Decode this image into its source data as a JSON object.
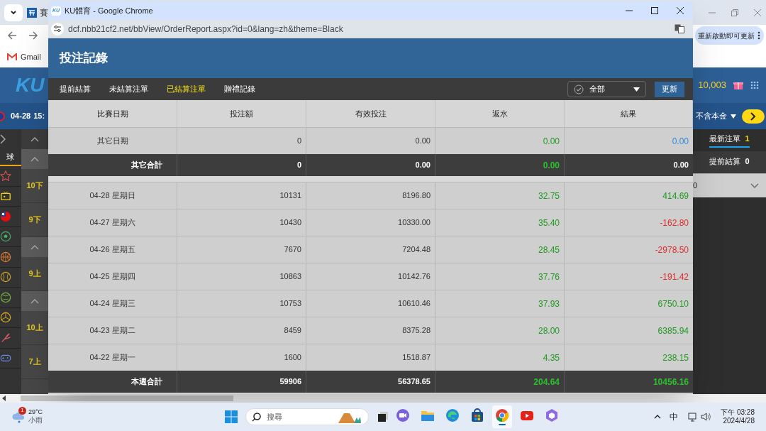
{
  "background_browser": {
    "tab_title": "賽",
    "update_notice": "重新啟動即可更新",
    "bookmarks": [
      "Gmail"
    ],
    "site": {
      "logo": "KU",
      "balance": "10,003",
      "date": "04-28",
      "time": "15:",
      "stake_option": "不含本金",
      "sports_tab": "球",
      "periods": [
        {
          "kind": "collapse"
        },
        {
          "kind": "collapse"
        },
        {
          "kind": "label",
          "text": "10下"
        },
        {
          "kind": "label",
          "text": "9下"
        },
        {
          "kind": "collapse"
        },
        {
          "kind": "label",
          "text": "9上"
        },
        {
          "kind": "collapse"
        },
        {
          "kind": "label",
          "text": "10上"
        },
        {
          "kind": "label",
          "text": "7上"
        }
      ],
      "sports": [
        {
          "kind": "star"
        },
        {
          "kind": "tv"
        },
        {
          "kind": "flag"
        },
        {
          "kind": "soccer"
        },
        {
          "kind": "basketball"
        },
        {
          "kind": "baseball"
        },
        {
          "kind": "tennis"
        },
        {
          "kind": "volleyball"
        },
        {
          "kind": "badminton"
        },
        {
          "kind": "gamepad"
        }
      ],
      "bet_tabs": [
        {
          "label": "最新注單",
          "count": "1",
          "selected": true
        },
        {
          "label": "提前結算",
          "count": "0",
          "selected": false
        }
      ],
      "bet_row": "0"
    }
  },
  "popup": {
    "favicon": "KU",
    "window_title": "KU體育 - Google Chrome",
    "url": "dcf.nbb21cf2.net/bbView/OrderReport.aspx?id=0&lang=zh&theme=Black",
    "page_title": "投注記錄",
    "tabs": [
      {
        "label": "提前結算",
        "selected": false
      },
      {
        "label": "未結算注單",
        "selected": false
      },
      {
        "label": "已結算注單",
        "selected": true
      },
      {
        "label": "贈禮記錄",
        "selected": false
      }
    ],
    "filter": "全部",
    "refresh_button": "更新",
    "columns": [
      "比賽日期",
      "投注額",
      "有效投注",
      "返水",
      "結果"
    ],
    "rows": [
      {
        "kind": "day",
        "date": "其它日期",
        "stake": "0",
        "valid": "0.00",
        "rebate": {
          "text": "0.00",
          "color": "#1f9a1f"
        },
        "result": {
          "text": "0.00",
          "color": "#2f8ae0"
        }
      },
      {
        "kind": "total",
        "date": "其它合計",
        "stake": "0",
        "valid": "0.00",
        "rebate": {
          "text": "0.00",
          "color": "#2cc02c"
        },
        "result": {
          "text": "0.00"
        }
      },
      {
        "kind": "spacer"
      },
      {
        "kind": "day",
        "date": "04-28 星期日",
        "stake": "10131",
        "valid": "8196.80",
        "rebate": {
          "text": "32.75",
          "color": "#1f9a1f"
        },
        "result": {
          "text": "414.69",
          "color": "#1f9a1f"
        }
      },
      {
        "kind": "day",
        "date": "04-27 星期六",
        "stake": "10430",
        "valid": "10330.00",
        "rebate": {
          "text": "35.40",
          "color": "#1f9a1f"
        },
        "result": {
          "text": "-162.80",
          "color": "#e02a2a"
        }
      },
      {
        "kind": "day",
        "date": "04-26 星期五",
        "stake": "7670",
        "valid": "7204.48",
        "rebate": {
          "text": "28.45",
          "color": "#1f9a1f"
        },
        "result": {
          "text": "-2978.50",
          "color": "#e02a2a"
        }
      },
      {
        "kind": "day",
        "date": "04-25 星期四",
        "stake": "10863",
        "valid": "10142.76",
        "rebate": {
          "text": "37.76",
          "color": "#1f9a1f"
        },
        "result": {
          "text": "-191.42",
          "color": "#e02a2a"
        }
      },
      {
        "kind": "day",
        "date": "04-24 星期三",
        "stake": "10753",
        "valid": "10610.46",
        "rebate": {
          "text": "37.93",
          "color": "#1f9a1f"
        },
        "result": {
          "text": "6750.10",
          "color": "#1f9a1f"
        }
      },
      {
        "kind": "day",
        "date": "04-23 星期二",
        "stake": "8459",
        "valid": "8375.28",
        "rebate": {
          "text": "28.00",
          "color": "#1f9a1f"
        },
        "result": {
          "text": "6385.94",
          "color": "#1f9a1f"
        }
      },
      {
        "kind": "day",
        "date": "04-22 星期一",
        "stake": "1600",
        "valid": "1518.87",
        "rebate": {
          "text": "4.35",
          "color": "#1f9a1f"
        },
        "result": {
          "text": "238.15",
          "color": "#1f9a1f"
        }
      },
      {
        "kind": "total",
        "date": "本週合計",
        "stake": "59906",
        "valid": "56378.65",
        "rebate": {
          "text": "204.64",
          "color": "#2cc02c"
        },
        "result": {
          "text": "10456.16",
          "color": "#2cc02c"
        }
      }
    ]
  },
  "taskbar": {
    "weather_badge": "1",
    "temperature": "29°C",
    "weather": "小雨",
    "search_placeholder": "搜尋",
    "apps": [
      {
        "kind": "meet",
        "selected": false
      },
      {
        "kind": "folder",
        "selected": false
      },
      {
        "kind": "edge",
        "selected": false
      },
      {
        "kind": "store",
        "selected": false
      },
      {
        "kind": "chrome",
        "selected": true
      },
      {
        "kind": "youtube",
        "selected": false
      },
      {
        "kind": "copilot",
        "selected": false
      }
    ],
    "ime": "中",
    "time": "下午 03:28",
    "date": "2024/4/28"
  }
}
